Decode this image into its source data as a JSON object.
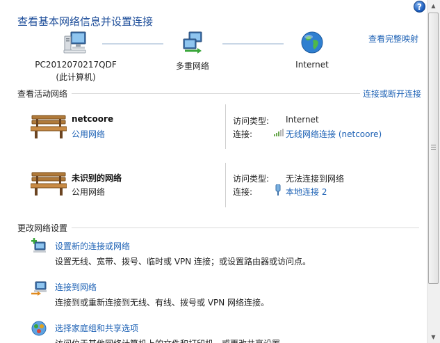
{
  "header": {
    "title": "查看基本网络信息并设置连接",
    "help_label": "?",
    "view_full_map": "查看完整映射"
  },
  "network_map": {
    "computer_name": "PC2012070217QDF",
    "computer_sub": "(此计算机)",
    "middle_label": "多重网络",
    "internet_label": "Internet"
  },
  "active_networks": {
    "section_title": "查看活动网络",
    "connect_link": "连接或断开连接",
    "networks": [
      {
        "name": "netcoore",
        "category": "公用网络",
        "access_type_label": "访问类型:",
        "access_type": "Internet",
        "connection_label": "连接:",
        "connection": "无线网络连接 (netcoore)",
        "connection_icon": "wifi-signal-icon"
      },
      {
        "name": "未识别的网络",
        "category": "公用网络",
        "access_type_label": "访问类型:",
        "access_type": "无法连接到网络",
        "connection_label": "连接:",
        "connection": "本地连接 2",
        "connection_icon": "ethernet-plug-icon"
      }
    ]
  },
  "change_settings": {
    "section_title": "更改网络设置",
    "tasks": [
      {
        "title": "设置新的连接或网络",
        "desc": "设置无线、宽带、拨号、临时或 VPN 连接；或设置路由器或访问点。",
        "icon": "new-connection-icon"
      },
      {
        "title": "连接到网络",
        "desc": "连接到或重新连接到无线、有线、拨号或 VPN 网络连接。",
        "icon": "connect-network-icon"
      },
      {
        "title": "选择家庭组和共享选项",
        "desc": "访问位于其他网络计算机上的文件和打印机，或更改共享设置。",
        "icon": "homegroup-icon"
      }
    ]
  },
  "colors": {
    "link": "#1e62b5",
    "title": "#1e4e9a"
  }
}
